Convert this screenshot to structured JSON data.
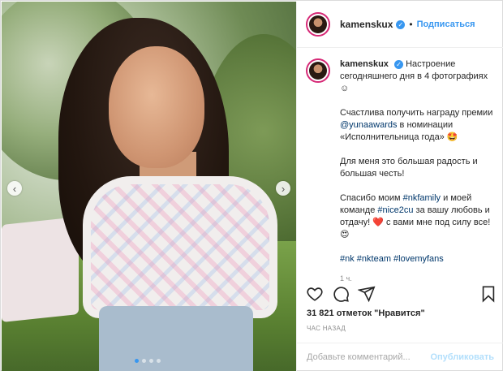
{
  "post": {
    "username": "kamenskux",
    "follow_label": "Подписаться",
    "separator": "•",
    "caption_lines": [
      "Настроение сегодняшнего дня в 4 фотографиях ☺",
      "Счастлива получить награду премии",
      "Для меня это большая радость и большая честь!",
      "Спасибо моим",
      "и моей команде",
      "за вашу любовь и отдачу!",
      "с вами мне под силу все!"
    ],
    "mention": "@yunaawards",
    "nomination_text": "в номинации «Исполнительница года» 🤩",
    "hashtags_inline": [
      "#nkfamily",
      "#nice2cu"
    ],
    "emoji_heart": "❤️",
    "emoji_love": "😍",
    "hashtags": "#nk #nkteam #lovemyfans",
    "time": "1 ч.",
    "likes": "31 821 отметок \"Нравится\"",
    "ago": "ЧАС НАЗАД",
    "comment_placeholder": "Добавьте комментарий...",
    "publish_label": "Опубликовать"
  },
  "icons": {
    "like": "heart-icon",
    "comment": "comment-icon",
    "share": "share-icon",
    "save": "bookmark-icon",
    "prev": "chevron-left-icon",
    "next": "chevron-right-icon"
  },
  "carousel": {
    "count": 4,
    "active_index": 0
  },
  "colors": {
    "accent": "#3897f0",
    "text": "#262626",
    "muted": "#8e8e8e",
    "tag": "#00376b"
  }
}
